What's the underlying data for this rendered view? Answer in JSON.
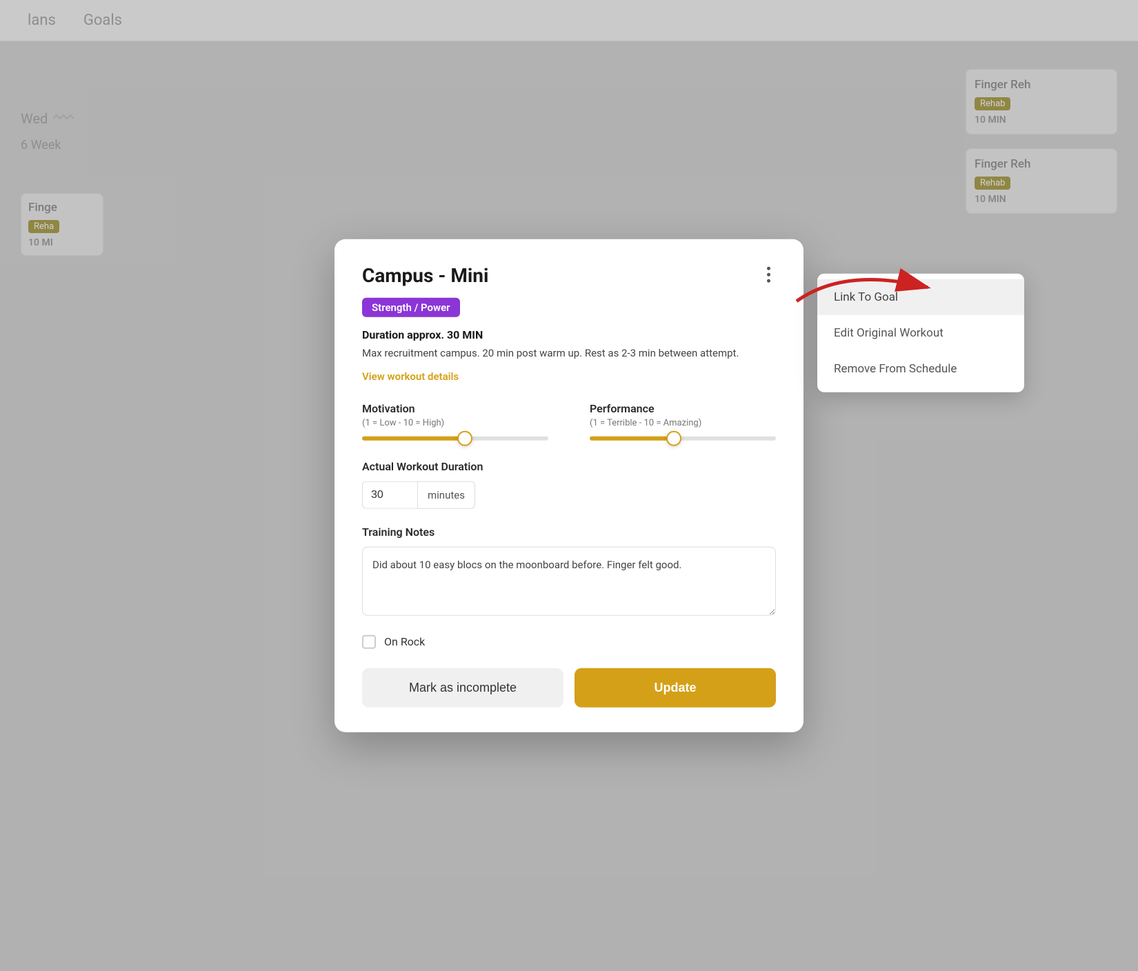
{
  "background": {
    "nav_items": [
      "lans",
      "Goals"
    ],
    "week_label": "6 Week",
    "wed_label": "Wed",
    "finger_reh_left_title": "Finge",
    "finger_reh_left_badge": "Reha",
    "finger_reh_left_duration": "10 MI",
    "cards_right": [
      {
        "title": "Finger Reh",
        "badge": "Rehab",
        "duration": "10 MIN"
      },
      {
        "title": "Finger Reh",
        "badge": "Rehab",
        "duration": "10 MIN"
      }
    ]
  },
  "modal": {
    "title": "Campus - Mini",
    "badge": "Strength / Power",
    "duration_text": "Duration approx. 30 MIN",
    "description": "Max recruitment campus. 20 min post warm up. Rest as 2-3 min between attempt.",
    "view_details": "View workout details",
    "motivation_label": "Motivation",
    "motivation_sublabel": "(1 = Low - 10 = High)",
    "motivation_value": 55,
    "performance_label": "Performance",
    "performance_sublabel": "(1 = Terrible - 10 = Amazing)",
    "performance_value": 45,
    "actual_duration_label": "Actual Workout Duration",
    "duration_input_value": "30",
    "duration_unit": "minutes",
    "training_notes_label": "Training Notes",
    "training_notes_value": "Did about 10 easy blocs on the moonboard before. Finger felt good.",
    "on_rock_label": "On Rock",
    "mark_incomplete_label": "Mark as incomplete",
    "update_label": "Update",
    "three_dots_label": "⋮"
  },
  "dropdown": {
    "items": [
      {
        "label": "Link To Goal",
        "highlighted": true
      },
      {
        "label": "Edit Original Workout",
        "highlighted": false
      },
      {
        "label": "Remove From Schedule",
        "highlighted": false
      }
    ]
  }
}
